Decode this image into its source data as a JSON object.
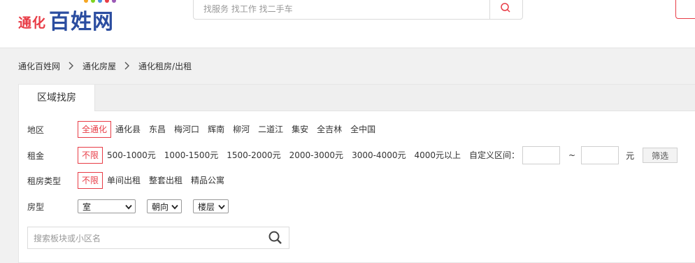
{
  "header": {
    "logo_city": "通化",
    "logo_brand": "百姓网",
    "search_placeholder": "找服务 找工作 找二手车"
  },
  "breadcrumb": [
    {
      "label": "通化百姓网"
    },
    {
      "label": "通化房屋"
    },
    {
      "label": "通化租房/出租"
    }
  ],
  "tabs": [
    {
      "label": "区域找房"
    }
  ],
  "filters": {
    "area": {
      "label": "地区",
      "selected": "全通化",
      "options": [
        "通化县",
        "东昌",
        "梅河口",
        "辉南",
        "柳河",
        "二道江",
        "集安",
        "全吉林",
        "全中国"
      ]
    },
    "rent": {
      "label": "租金",
      "selected": "不限",
      "options": [
        "500-1000元",
        "1000-1500元",
        "1500-2000元",
        "2000-3000元",
        "3000-4000元",
        "4000元以上"
      ],
      "custom_label": "自定义区间：",
      "tilde": "~",
      "unit": "元",
      "filter_button": "筛选"
    },
    "rent_type": {
      "label": "租房类型",
      "selected": "不限",
      "options": [
        "单间出租",
        "整套出租",
        "精品公寓"
      ]
    },
    "layout": {
      "label": "房型",
      "room": "室",
      "orientation": "朝向",
      "floor": "楼层"
    }
  },
  "area_search": {
    "placeholder": "搜索板块或小区名"
  },
  "colors": {
    "accent": "#e83c46",
    "brand": "#2b4da0"
  }
}
